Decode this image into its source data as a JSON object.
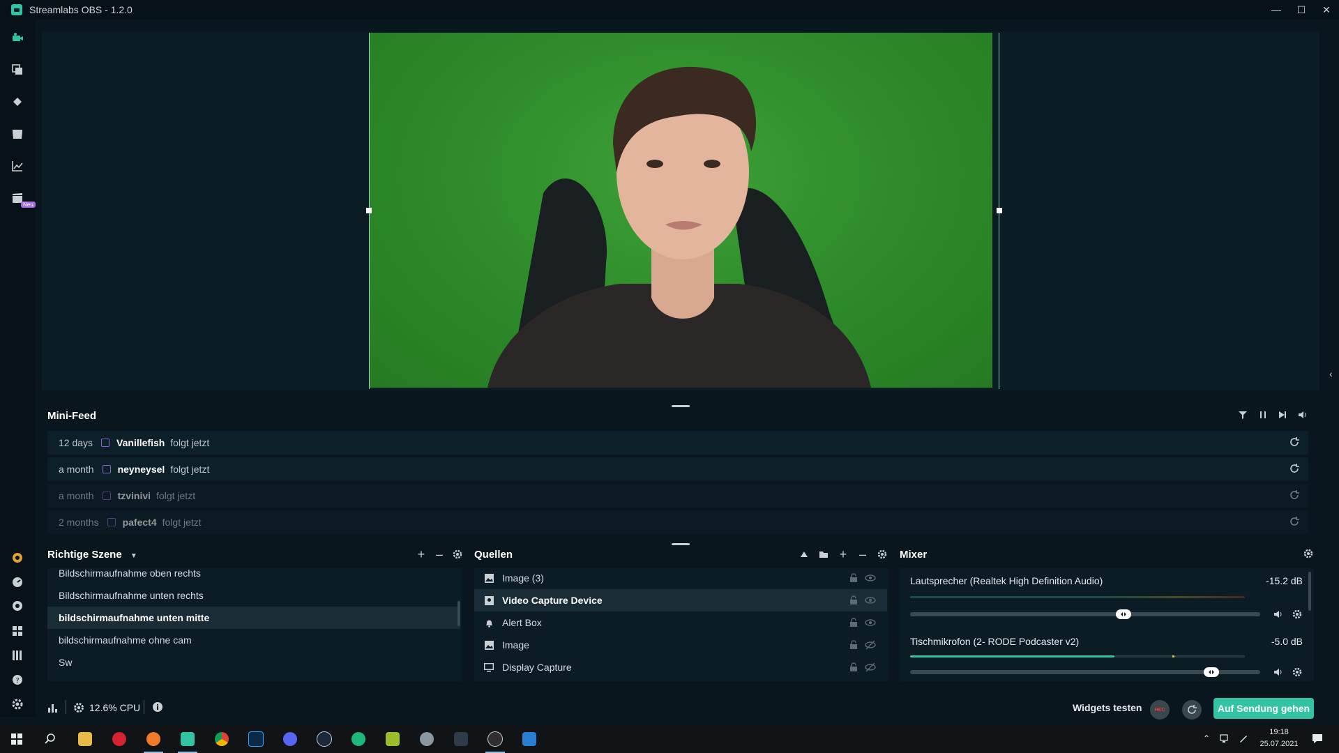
{
  "window": {
    "title": "Streamlabs OBS - 1.2.0"
  },
  "nav": {
    "new_badge": "Neu"
  },
  "mini_feed": {
    "title": "Mini-Feed",
    "items": [
      {
        "age": "12 days",
        "name": "Vanillefish",
        "action": "folgt jetzt"
      },
      {
        "age": "a month",
        "name": "neyneysel",
        "action": "folgt jetzt"
      },
      {
        "age": "a month",
        "name": "tzvinivi",
        "action": "folgt jetzt"
      },
      {
        "age": "2 months",
        "name": "pafect4",
        "action": "folgt jetzt"
      }
    ]
  },
  "scenes": {
    "title": "Richtige Szene",
    "items": [
      "Bildschirmaufnahme oben rechts",
      "Bildschirmaufnahme unten rechts",
      "bildschirmaufnahme unten mitte",
      "bildschirmaufnahme ohne cam",
      "Sw"
    ],
    "active_index": 2
  },
  "sources": {
    "title": "Quellen",
    "items": [
      {
        "name": "Image (3)",
        "icon": "image-icon"
      },
      {
        "name": "Video Capture Device",
        "icon": "webcam-icon"
      },
      {
        "name": "Alert Box",
        "icon": "bell-icon"
      },
      {
        "name": "Image",
        "icon": "image-icon"
      },
      {
        "name": "Display Capture",
        "icon": "monitor-icon"
      }
    ],
    "active_index": 1
  },
  "mixer": {
    "title": "Mixer",
    "channels": [
      {
        "name": "Lautsprecher (Realtek High Definition Audio)",
        "db": "-15.2 dB",
        "volume": 0.61
      },
      {
        "name": "Tischmikrofon (2- RODE Podcaster v2)",
        "db": "-5.0 dB",
        "volume": 0.86
      }
    ]
  },
  "status": {
    "cpu": "12.6% CPU",
    "test_widgets": "Widgets testen",
    "rec_label": "REC",
    "go_live": "Auf Sendung gehen"
  },
  "taskbar": {
    "time": "19:18",
    "date": "25.07.2021"
  },
  "colors": {
    "accent": "#31c3a2",
    "bg": "#09161d",
    "panel": "#0c1c25",
    "twitch": "#8d63cf"
  }
}
